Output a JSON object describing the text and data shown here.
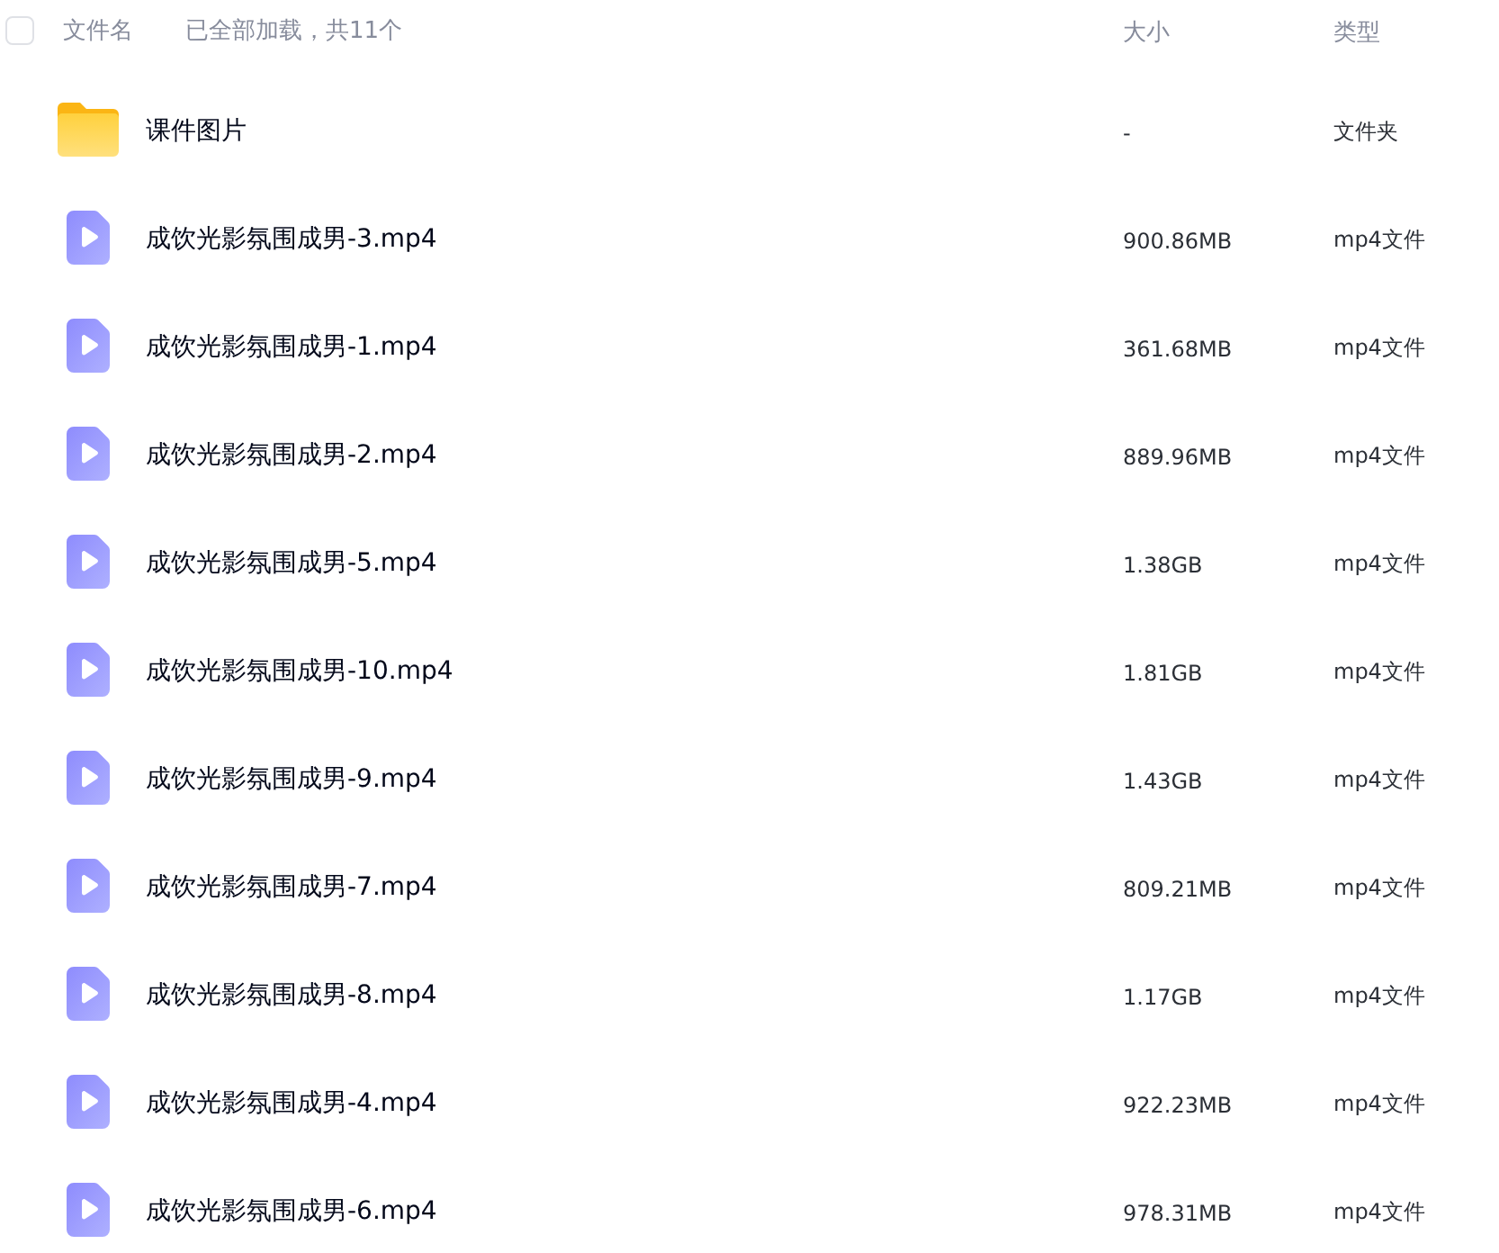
{
  "header": {
    "select_all": {
      "checked": false
    },
    "name_column": "文件名",
    "load_status": "已全部加载，共11个",
    "size_column": "大小",
    "type_column": "类型"
  },
  "files": [
    {
      "kind": "folder",
      "name": "课件图片",
      "size": "-",
      "type": "文件夹"
    },
    {
      "kind": "video",
      "name": "成饮光影氛围成男-3.mp4",
      "size": "900.86MB",
      "type": "mp4文件"
    },
    {
      "kind": "video",
      "name": "成饮光影氛围成男-1.mp4",
      "size": "361.68MB",
      "type": "mp4文件"
    },
    {
      "kind": "video",
      "name": "成饮光影氛围成男-2.mp4",
      "size": "889.96MB",
      "type": "mp4文件"
    },
    {
      "kind": "video",
      "name": "成饮光影氛围成男-5.mp4",
      "size": "1.38GB",
      "type": "mp4文件"
    },
    {
      "kind": "video",
      "name": "成饮光影氛围成男-10.mp4",
      "size": "1.81GB",
      "type": "mp4文件"
    },
    {
      "kind": "video",
      "name": "成饮光影氛围成男-9.mp4",
      "size": "1.43GB",
      "type": "mp4文件"
    },
    {
      "kind": "video",
      "name": "成饮光影氛围成男-7.mp4",
      "size": "809.21MB",
      "type": "mp4文件"
    },
    {
      "kind": "video",
      "name": "成饮光影氛围成男-8.mp4",
      "size": "1.17GB",
      "type": "mp4文件"
    },
    {
      "kind": "video",
      "name": "成饮光影氛围成男-4.mp4",
      "size": "922.23MB",
      "type": "mp4文件"
    },
    {
      "kind": "video",
      "name": "成饮光影氛围成男-6.mp4",
      "size": "978.31MB",
      "type": "mp4文件"
    }
  ]
}
